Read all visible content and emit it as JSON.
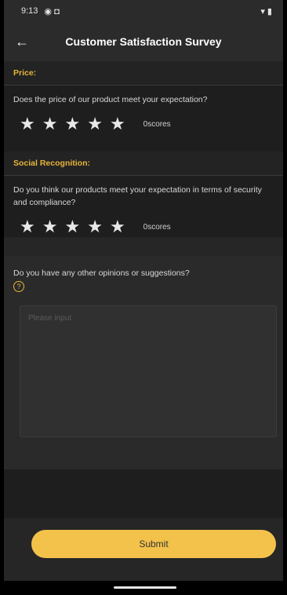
{
  "status": {
    "time": "9:13",
    "left_icons": "◉ ◘",
    "right_icons": "▾ ▮"
  },
  "app_bar": {
    "back_icon": "arrow-left-icon",
    "back_glyph": "←",
    "title": "Customer Satisfaction Survey"
  },
  "sections": [
    {
      "header": "Price:",
      "question": "Does the price of our product meet your expectation?",
      "rating": 0,
      "score_label": "0scores",
      "star_glyph": "★"
    },
    {
      "header": "Social Recognition:",
      "question": "Do you think our products meet your expectation in terms of security and compliance?",
      "rating": 0,
      "score_label": "0scores",
      "star_glyph": "★"
    }
  ],
  "opinion": {
    "question": "Do you have any other opinions or suggestions?",
    "help_glyph": "?",
    "placeholder": "Please input"
  },
  "footer": {
    "submit_label": "Submit"
  },
  "colors": {
    "accent": "#f3c24b",
    "header_text": "#e7b53a",
    "background": "#1e1e1e"
  }
}
